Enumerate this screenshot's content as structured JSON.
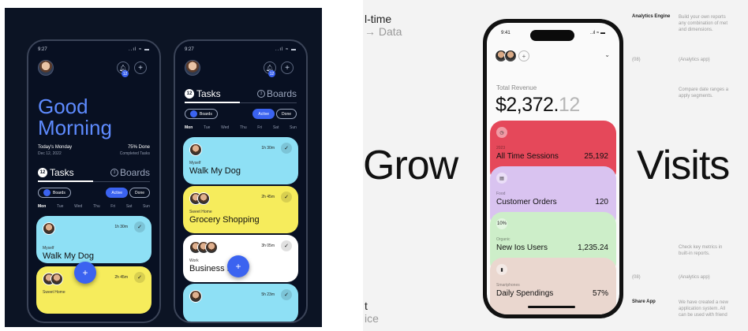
{
  "left": {
    "phone_a": {
      "time": "9:27",
      "signal": "..ıl ≈ ▬",
      "bell_badge": "12",
      "greeting_line1": "Good",
      "greeting_line2": "Morning",
      "day_label": "Today's Monday",
      "day_date": "Dec 12, 2022",
      "progress_label": "75% Done",
      "progress_sub": "Completed Tasks",
      "tasks_count": "12",
      "tasks_label": "Tasks",
      "boards_count": "3",
      "boards_label": "Boards",
      "boards_pill": "Boards",
      "active_pill": "Active",
      "done_pill": "Done",
      "week": [
        "Mon",
        "Tue",
        "Wed",
        "Thu",
        "Fri",
        "Sat",
        "Sun"
      ],
      "cards": [
        {
          "time": "1h 30m",
          "sub": "Myself",
          "title": "Walk My Dog"
        },
        {
          "time": "2h 45m",
          "sub": "Sweet Home",
          "title": ""
        }
      ],
      "fab": "+"
    },
    "phone_b": {
      "time": "9:27",
      "signal": "..ıl ≈ ▬",
      "bell_badge": "12",
      "tasks_count": "12",
      "tasks_label": "Tasks",
      "boards_count": "3",
      "boards_label": "Boards",
      "boards_pill": "Boards",
      "active_pill": "Active",
      "done_pill": "Done",
      "week": [
        "Mon",
        "Tue",
        "Wed",
        "Thu",
        "Fri",
        "Sat",
        "Sun"
      ],
      "cards": [
        {
          "time": "1h 30m",
          "sub": "Myself",
          "title": "Walk My Dog"
        },
        {
          "time": "2h 45m",
          "sub": "Sweet Home",
          "title": "Grocery Shopping"
        },
        {
          "time": "3h 05m",
          "sub": "Work",
          "title": "Business M"
        },
        {
          "time": "5h 23m",
          "sub": "",
          "title": ""
        }
      ],
      "fab": "+"
    }
  },
  "right": {
    "top_left_line1": "l-time",
    "top_left_line2": "→ Data",
    "bottom_left_line1": "t",
    "bottom_left_line2": "ice",
    "big_left": "Grow",
    "big_right": "Visits",
    "side": {
      "item1_head": "Analytics Engine",
      "item1_text": [
        "Build your own reports",
        "any combination of met",
        "and dimensions."
      ],
      "item2_num": "(08)",
      "item2_text": "(Analytics app)",
      "item3_text": [
        "Compare date ranges a",
        "apply segments."
      ],
      "item4_text": [
        "Check key metrics in",
        "built-in reports."
      ],
      "item5_num": "(08)",
      "item5_text": "(Analytics app)",
      "item6_head": "Share App",
      "item6_text": [
        "We have created a new",
        "application system. All",
        "can be used with friend"
      ]
    },
    "phone": {
      "time": "9:41",
      "signal": "..ıl ≈ ▬",
      "chevron": "⌄",
      "plus": "+",
      "revenue_label": "Total Revenue",
      "revenue_main": "$2,372.",
      "revenue_cents": "12",
      "metrics": [
        {
          "sub": "2023",
          "title": "All Time Sessions",
          "value": "25,192",
          "icon": "◷"
        },
        {
          "sub": "Food",
          "title": "Customer Orders",
          "value": "120",
          "icon": "▤"
        },
        {
          "sub": "Organic",
          "title": "New Ios Users",
          "value": "1,235.24",
          "icon": "10%"
        },
        {
          "sub": "Smartphones",
          "title": "Daily Spendings",
          "value": "57%",
          "icon": "▮"
        }
      ]
    }
  }
}
